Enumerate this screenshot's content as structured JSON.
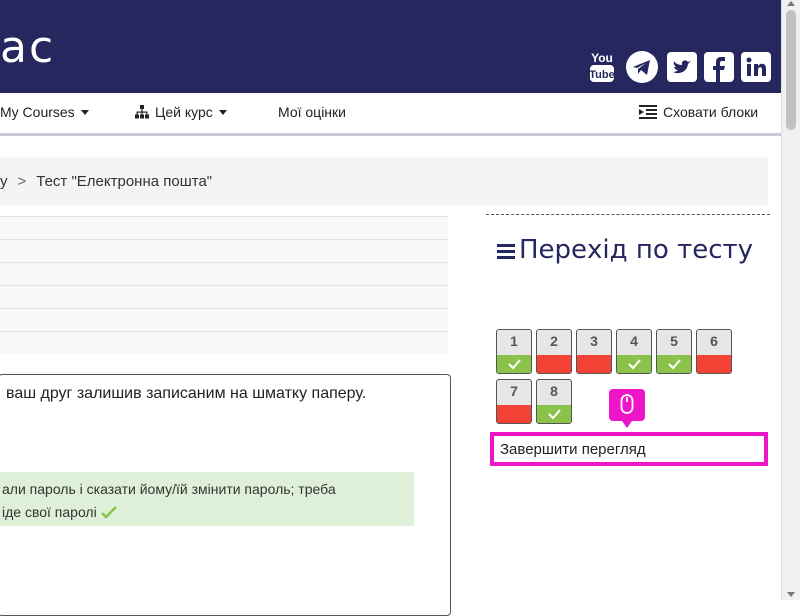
{
  "header": {
    "logo_text": "ас",
    "background": "#27275f",
    "social": [
      {
        "name": "youtube-icon",
        "label_top": "You",
        "label_bottom": "Tube"
      },
      {
        "name": "telegram-icon"
      },
      {
        "name": "twitter-icon"
      },
      {
        "name": "facebook-icon"
      },
      {
        "name": "linkedin-icon"
      }
    ]
  },
  "navbar": {
    "my_courses": "My Courses",
    "this_course": "Цей курс",
    "my_grades": "Мої оцінки",
    "hide_blocks": "Сховати блоки"
  },
  "breadcrumb": {
    "partial": "у",
    "separator": ">",
    "current": "Тест \"Електронна пошта\""
  },
  "question": {
    "text": "ваш друг залишив записаним на шматку паперу.",
    "answer_line1": "али пароль і сказати йому/їй змінити пароль; треба",
    "answer_line2": "іде свої паролі"
  },
  "quiz_nav": {
    "title": "Перехід по тесту",
    "questions": [
      {
        "num": "1",
        "status": "correct"
      },
      {
        "num": "2",
        "status": "incorrect"
      },
      {
        "num": "3",
        "status": "incorrect"
      },
      {
        "num": "4",
        "status": "correct"
      },
      {
        "num": "5",
        "status": "correct"
      },
      {
        "num": "6",
        "status": "incorrect"
      },
      {
        "num": "7",
        "status": "incorrect"
      },
      {
        "num": "8",
        "status": "correct"
      }
    ],
    "finish_review": "Завершити перегляд"
  },
  "colors": {
    "accent": "#27275f",
    "correct": "#8bc34a",
    "incorrect": "#f44336",
    "highlight": "#ee14c8"
  }
}
